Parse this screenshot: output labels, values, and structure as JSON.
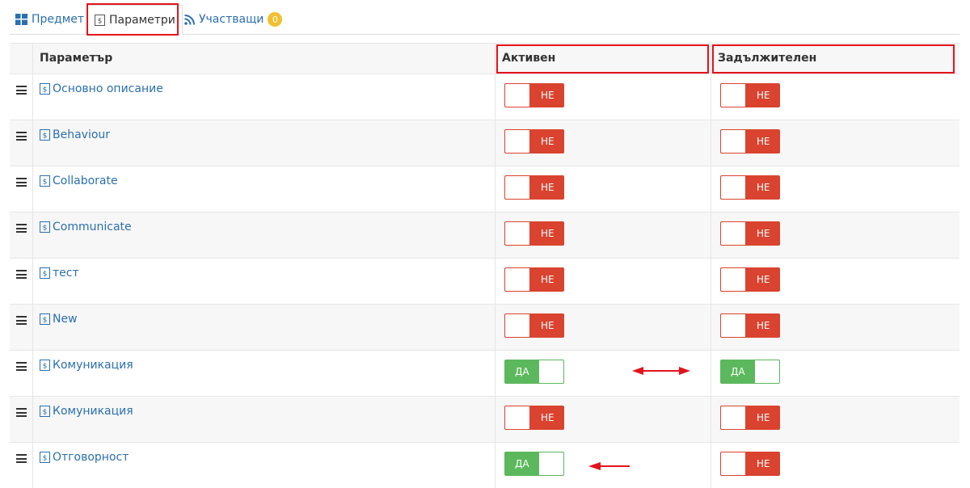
{
  "tabs": {
    "subject": "Предмет",
    "parameters": "Параметри",
    "participants": "Участващи",
    "participants_count": "0"
  },
  "table": {
    "headers": {
      "parameter": "Параметър",
      "active": "Активен",
      "required": "Задължителен"
    },
    "rows": [
      {
        "name": "Основно описание",
        "active": "НЕ",
        "required": "НЕ"
      },
      {
        "name": "Behaviour",
        "active": "НЕ",
        "required": "НЕ"
      },
      {
        "name": "Collaborate",
        "active": "НЕ",
        "required": "НЕ"
      },
      {
        "name": "Communicate",
        "active": "НЕ",
        "required": "НЕ"
      },
      {
        "name": "тест",
        "active": "НЕ",
        "required": "НЕ"
      },
      {
        "name": "New",
        "active": "НЕ",
        "required": "НЕ"
      },
      {
        "name": "Комуникация",
        "active": "ДА",
        "required": "ДА"
      },
      {
        "name": "Комуникация",
        "active": "НЕ",
        "required": "НЕ"
      },
      {
        "name": "Отговорност",
        "active": "ДА",
        "required": "НЕ"
      }
    ]
  },
  "colors": {
    "link": "#2a6fb0",
    "toggle_on": "#5cb85c",
    "toggle_off": "#d9432f",
    "badge": "#f0c030",
    "highlight": "#e3131c"
  }
}
